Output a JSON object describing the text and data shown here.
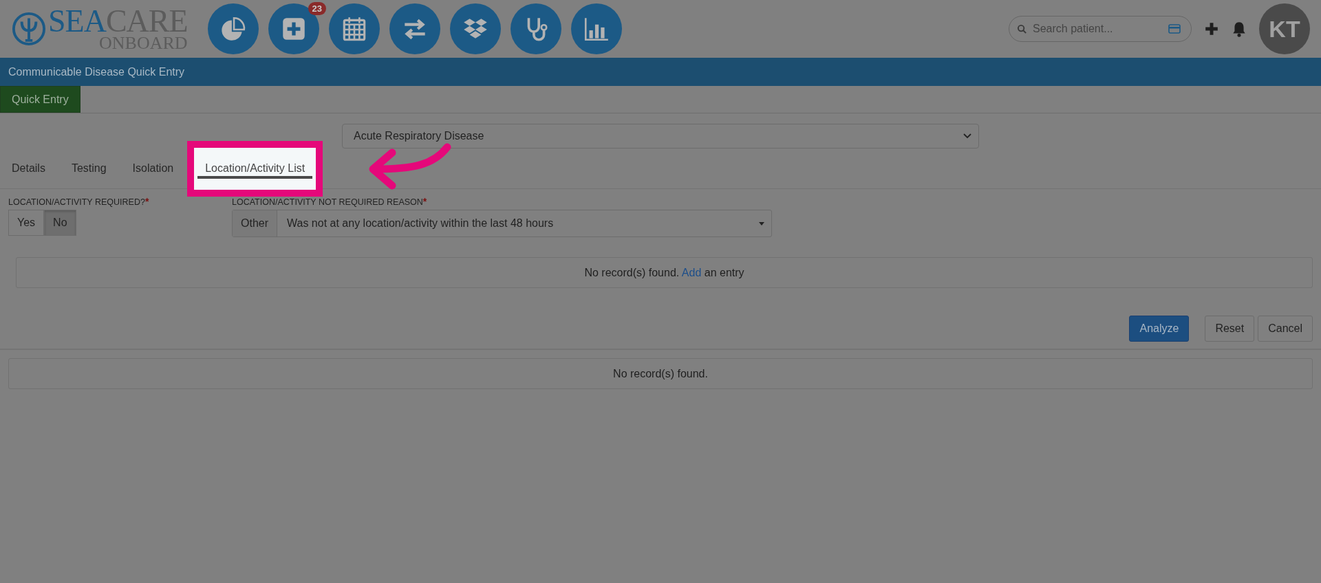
{
  "logo": {
    "part_1": "SEA",
    "part_2": "CARE",
    "subtitle": "ONBOARD"
  },
  "nav_icons": [
    {
      "kind": "pie"
    },
    {
      "kind": "plus",
      "badge": "23"
    },
    {
      "kind": "calendar"
    },
    {
      "kind": "swap"
    },
    {
      "kind": "boxes"
    },
    {
      "kind": "stethoscope"
    },
    {
      "kind": "bars"
    }
  ],
  "search": {
    "placeholder": "Search patient..."
  },
  "avatar": {
    "initials": "KT"
  },
  "page_title": "Communicable Disease Quick Entry",
  "top_tabs": [
    {
      "label": "Quick Entry",
      "selected": true
    }
  ],
  "disease_select": {
    "value": "Acute Respiratory Disease"
  },
  "tabs": [
    {
      "label": "Details",
      "selected": false,
      "highlighted": false
    },
    {
      "label": "Testing",
      "selected": false,
      "highlighted": false
    },
    {
      "label": "Isolation",
      "selected": false,
      "highlighted": false
    },
    {
      "label": "Location/Activity List",
      "selected": true,
      "highlighted": true
    }
  ],
  "required_field": {
    "label": "LOCATION/ACTIVITY REQUIRED?",
    "required_mark": "*",
    "options": [
      {
        "label": "Yes",
        "selected": false
      },
      {
        "label": "No",
        "selected": true
      }
    ]
  },
  "reason_field": {
    "label": "LOCATION/ACTIVITY NOT REQUIRED REASON",
    "required_mark": "*",
    "prefix": "Other",
    "value": "Was not at any location/activity within the last 48 hours"
  },
  "entries": {
    "empty_before": "No record(s) found.",
    "link": "Add",
    "empty_after": "an entry"
  },
  "buttons": [
    {
      "label": "Analyze",
      "kind": "primary"
    },
    {
      "label": "Reset",
      "kind": "default"
    },
    {
      "label": "Cancel",
      "kind": "default"
    }
  ],
  "results": {
    "empty": "No record(s) found."
  }
}
